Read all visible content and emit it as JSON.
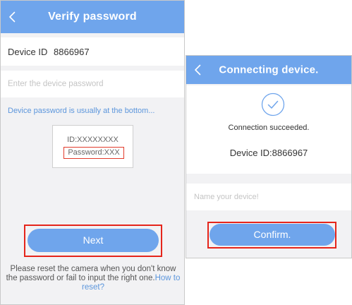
{
  "left_screen": {
    "header": {
      "title": "Verify password",
      "back_icon": "chevron-left-icon"
    },
    "device_id": {
      "label": "Device ID",
      "value": "8866967"
    },
    "password_field": {
      "placeholder": "Enter the device password",
      "value": ""
    },
    "hint": "Device password is usually at the bottom...",
    "device_label": {
      "id_text": "ID:XXXXXXXX",
      "password_text": "Password:XXX"
    },
    "next_button": {
      "label": "Next"
    },
    "help": {
      "text": "Please reset the camera when you don't know the password or fail to input the right one.",
      "link": "How to reset?"
    }
  },
  "right_screen": {
    "header": {
      "title": "Connecting device.",
      "back_icon": "chevron-left-icon"
    },
    "status": {
      "icon": "check-circle-icon",
      "text": "Connection succeeded."
    },
    "device_id": "Device ID:8866967",
    "name_field": {
      "placeholder": "Name your device!",
      "value": ""
    },
    "confirm_button": {
      "label": "Confirm."
    }
  },
  "colors": {
    "accent": "#6fa5ec",
    "link": "#5c96dc",
    "highlight": "#e5251b",
    "background": "#f2f2f4"
  }
}
